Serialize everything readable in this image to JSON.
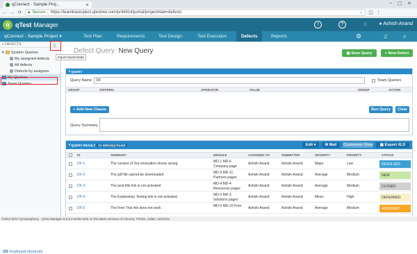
{
  "browser": {
    "tab_title": "qConnect - Sample Proj...",
    "secure_label": "Secure",
    "url": "https://learnbasicqtest.qtestnet.com/p/44914/portal/project#tab=defects"
  },
  "header": {
    "logo_text": "q",
    "brand": "qTest",
    "product": "Manager",
    "user_name": "Ashish Anand"
  },
  "nav": {
    "project": "qConnect - Sample Project ▾",
    "items": [
      "Test Plan",
      "Requirements",
      "Test Design",
      "Test Execution",
      "Defects",
      "Reports"
    ]
  },
  "sidebar": {
    "title": "DEFECTS",
    "system_queries": "System Queries",
    "items": [
      "My assigned defects",
      "All defects",
      "Defects by assignee"
    ],
    "my_queries": "My Queries",
    "team_queries": "Team Queries",
    "tooltip": "Import Saved Data",
    "keyboard": "Keyboard shortcuts"
  },
  "footer": {
    "copyright": "©2013-2017 QASymphony - qTest Manager 8.3.3.2 works best on the latest versions of Chrome, Firefox, Safari, and IE11."
  },
  "main": {
    "title_prefix": "Defect Query:",
    "title_name": "New Query",
    "save_query": "Save Query",
    "new_defect": "New Defect",
    "query_panel": "QUERY",
    "query_name_label": "Query Name",
    "query_name_value": "DF",
    "team_queries_label": "Team Queries",
    "columns": [
      "GROUP",
      "CRITERIA",
      "OPERATOR",
      "VALUE",
      "GROUP",
      "ACTION"
    ],
    "add_clause": "Add New Clause",
    "run_query": "Run Query",
    "clear": "Clear",
    "summary_label": "Query Summary",
    "result_label": "QUERY RESULT",
    "result_count": "12 defect(s) found",
    "edit": "Edit ▾",
    "mail": "Mail",
    "customize_view": "Customize View",
    "export": "Export XLS",
    "result_columns": [
      "ID",
      "SUMMARY",
      "MODULE",
      "ASSIGNED TO",
      "SUBMITTER",
      "SEVERITY",
      "PRIORITY",
      "STATUS"
    ],
    "rows": [
      {
        "id": "DF-1",
        "summary": "The content of Our innovation shows wrong",
        "module1": "MD-1 MD-6",
        "module2": "Company page",
        "assigned": "Ashish Anand",
        "submitter": "Ashish Anand",
        "severity": "Major",
        "priority": "Low",
        "status": "RESOLVED"
      },
      {
        "id": "DF-2",
        "summary": "The pdf file cannot be downloaded",
        "module1": "MD-3 MD-11",
        "module2": "Partners pages",
        "assigned": "Ashish Anand",
        "submitter": "Ashish Anand",
        "severity": "Average",
        "priority": "Medium",
        "status": "NEW"
      },
      {
        "id": "DF-3",
        "summary": "The post title link is not activated",
        "module1": "MD-4 MD-4",
        "module2": "Resources pages",
        "assigned": "Ashish Anand",
        "submitter": "Ashish Anand",
        "severity": "Average",
        "priority": "Medium",
        "status": "CLOSED"
      },
      {
        "id": "DF-4",
        "summary": "The Exploratory Testing link is not activated",
        "module1": "MD-3 MD-3",
        "module2": "Solutions pages",
        "assigned": "Ashish Anand",
        "submitter": "Ashish Anand",
        "severity": "Minor",
        "priority": "High",
        "status": "DEFERRED"
      },
      {
        "id": "DF-5",
        "summary": "The Free Trial link does not work",
        "module1": "MD-6 MD-10 Free",
        "module2": "",
        "assigned": "Ashish Anand",
        "submitter": "Ashish Anand",
        "severity": "Average",
        "priority": "Medium",
        "status": "ASSIGNED"
      }
    ]
  },
  "colors": {
    "header": "#1f6d8c",
    "nav": "#2a88ad",
    "accent_green": "#4caf50",
    "accent_blue": "#2c8ac9",
    "status_resolved": "#3d9fd4",
    "status_new": "#c8e6a8",
    "status_closed": "#d0d0d0",
    "status_deferred": "#f8f0c8",
    "status_assigned": "#f5a623"
  }
}
